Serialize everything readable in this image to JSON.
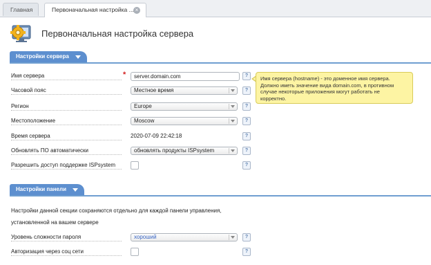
{
  "tabs": [
    {
      "label": "Главная"
    },
    {
      "label": "Первоначальная настройка ..."
    }
  ],
  "page_title": "Первоначальная настройка сервера",
  "sections": {
    "server": {
      "title": "Настройки сервера",
      "fields": {
        "hostname": {
          "label": "Имя сервера",
          "value": "server.domain.com"
        },
        "timezone": {
          "label": "Часовой пояс",
          "value": "Местное время"
        },
        "region": {
          "label": "Регион",
          "value": "Europe"
        },
        "location": {
          "label": "Местоположение",
          "value": "Moscow"
        },
        "server_time": {
          "label": "Время сервера",
          "value": "2020-07-09 22:42:18"
        },
        "auto_update": {
          "label": "Обновлять ПО автоматически",
          "value": "обновлять продукты ISPsystem"
        },
        "support_access": {
          "label": "Разрешить доступ поддержке ISPsystem"
        }
      }
    },
    "panel": {
      "title": "Настройки панели",
      "note_line1": "Настройки данной секции сохраняются отдельно для каждой панели управления,",
      "note_line2": "установленной на вашем сервере",
      "fields": {
        "password_strength": {
          "label": "Уровень сложности пароля",
          "value": "хороший"
        },
        "social_auth": {
          "label": "Авторизация через соц сети"
        }
      }
    }
  },
  "tooltip": {
    "line1": "Имя сервера (hostname) - это доменное имя сервера.",
    "line2": "Должно иметь значение вида domain.com, в противном",
    "line3": "случае некоторые приложения могут работать не",
    "line4": "корректно."
  },
  "help_glyph": "?",
  "required_glyph": "*",
  "close_glyph": "×",
  "colors": {
    "section_blue": "#5d8fcf",
    "tooltip_bg": "#fdf4a3",
    "required_red": "#d32020",
    "link_blue": "#3a66c4"
  },
  "icons": {
    "page": "gear-monitor-icon",
    "help": "help-icon",
    "close": "close-icon",
    "collapse": "chevron-down-icon"
  }
}
